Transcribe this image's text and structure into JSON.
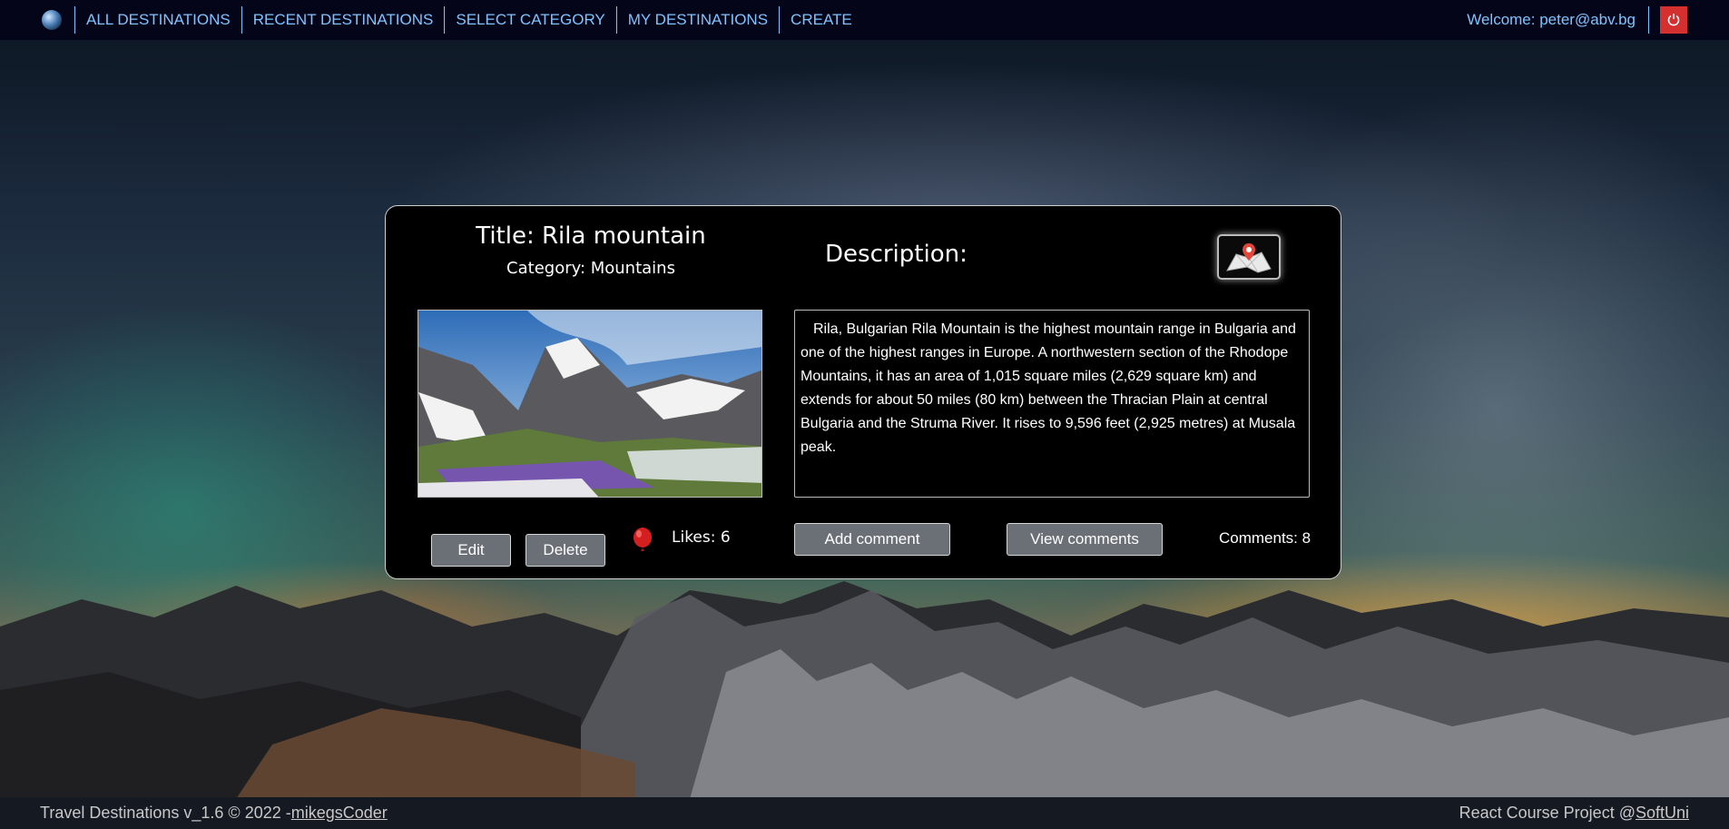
{
  "nav": {
    "links": [
      "ALL DESTINATIONS",
      "RECENT DESTINATIONS",
      "SELECT CATEGORY",
      "MY DESTINATIONS",
      "CREATE"
    ],
    "welcome": "Welcome: peter@abv.bg",
    "logo_icon": "globe-icon",
    "logout_icon": "power-icon"
  },
  "destination": {
    "title": "Title: Rila mountain",
    "category": "Category: Mountains",
    "description_heading": "Description:",
    "description": "Rila, Bulgarian Rila Mountain is the highest mountain range in Bulgaria and one of the highest ranges in Europe. A northwestern section of the Rhodope Mountains, it has an area of 1,015 square miles (2,629 square km) and extends for about 50 miles (80 km) between the Thracian Plain at central Bulgaria and the Struma River. It rises to 9,596 feet (2,925 metres) at Musala peak.",
    "map_icon": "map-icon"
  },
  "actions": {
    "edit": "Edit",
    "delete": "Delete",
    "likes": "Likes: 6",
    "add_comment": "Add comment",
    "view_comments": "View comments",
    "comments": "Comments: 8"
  },
  "footer": {
    "left_text": "Travel Destinations v_1.6 © 2022 -",
    "left_link": "mikegsCoder",
    "right_text": "React Course Project @",
    "right_link": "SoftUni"
  },
  "colors": {
    "nav_bg": "#05051a",
    "nav_link": "#7fc3ff",
    "logout": "#d4302f",
    "button": "#6b7077"
  }
}
